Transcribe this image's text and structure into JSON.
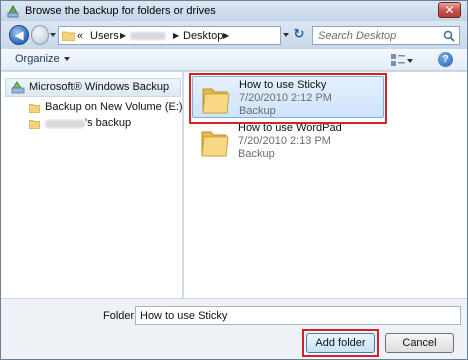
{
  "window": {
    "title": "Browse the backup for folders or drives",
    "close_glyph": "✕"
  },
  "navbar": {
    "back_glyph": "◀",
    "breadcrumbs": [
      "Users",
      "Desktop"
    ],
    "breadcrumb_prefix": "«",
    "refresh_glyph": "↻",
    "search_placeholder": "Search Desktop"
  },
  "toolbar": {
    "organize_label": "Organize",
    "help_glyph": "?"
  },
  "nav_pane": {
    "root_label": "Microsoft® Windows Backup",
    "items": [
      {
        "label": "Backup on New Volume (E:)"
      },
      {
        "label": "'s backup"
      }
    ]
  },
  "files": [
    {
      "name": "How to use Sticky",
      "date": "7/20/2010 2:12 PM",
      "type": "Backup",
      "selected": true
    },
    {
      "name": "How to use WordPad",
      "date": "7/20/2010 2:13 PM",
      "type": "Backup",
      "selected": false
    }
  ],
  "footer": {
    "folder_label": "Folder:",
    "folder_value": "How to use Sticky",
    "add_folder_label": "Add folder",
    "cancel_label": "Cancel"
  },
  "colors": {
    "highlight": "#d2222a",
    "selection": "#cde3fb",
    "folder_yellow": "#f5d27a"
  }
}
